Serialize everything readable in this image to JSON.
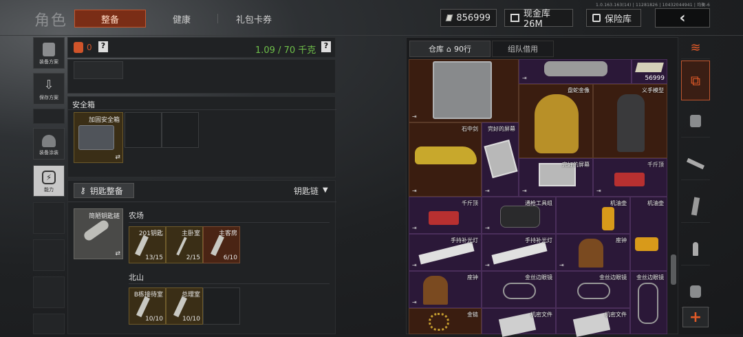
{
  "header": {
    "title": "角色",
    "tabs": [
      {
        "label": "整备",
        "active": true
      },
      {
        "label": "健康"
      },
      {
        "label": "礼包卡券"
      }
    ],
    "version_text": "1.0.163.163(14) | 11281826 | 10432044941 | 均衡-6",
    "currency_value": "856999",
    "cash_label": "现金库 26M",
    "vault_label": "保险库"
  },
  "sidebar": [
    {
      "label": "装备方案"
    },
    {
      "label": "保存方案"
    },
    {
      "label": ""
    },
    {
      "label": "装备涂装"
    },
    {
      "label": "能力"
    }
  ],
  "stats": {
    "count": "0",
    "help": "?",
    "weight": "1.09 / 70 千克",
    "help2": "?"
  },
  "safe": {
    "header": "安全箱",
    "item": "加固安全箱"
  },
  "keys": {
    "button": "钥匙整备",
    "chain": "钥匙链",
    "chain_item": "简陋钥匙链",
    "group1": "农场",
    "keys1": [
      {
        "name": "201钥匙",
        "count": "13/15"
      },
      {
        "name": "主卧室",
        "count": "2/15"
      },
      {
        "name": "主客房",
        "count": "6/10"
      }
    ],
    "group2": "北山",
    "keys2": [
      {
        "name": "B栋接待室",
        "count": "10/10"
      },
      {
        "name": "总理室",
        "count": "10/10"
      }
    ]
  },
  "storage": {
    "tab1": "仓库",
    "tab1_count": "90行",
    "tab2": "组队借用",
    "money_count": "56999",
    "items": [
      "盘蛇金像",
      "义手模型",
      "石中剑",
      "完好的屏幕",
      "完好的屏幕",
      "千斤顶",
      "千斤顶",
      "通枪工具组",
      "机油壶",
      "机油壶",
      "手持补光灯",
      "手持补光灯",
      "座钟",
      "座钟",
      "金丝边眼镜",
      "金丝边眼镜",
      "金丝边眼镜",
      "金链",
      "机密文件",
      "机密文件"
    ]
  },
  "colors": {
    "accent": "#c2562e",
    "weight": "#6fc04a",
    "brown": "#3a1d10",
    "purple": "#2b1838"
  }
}
